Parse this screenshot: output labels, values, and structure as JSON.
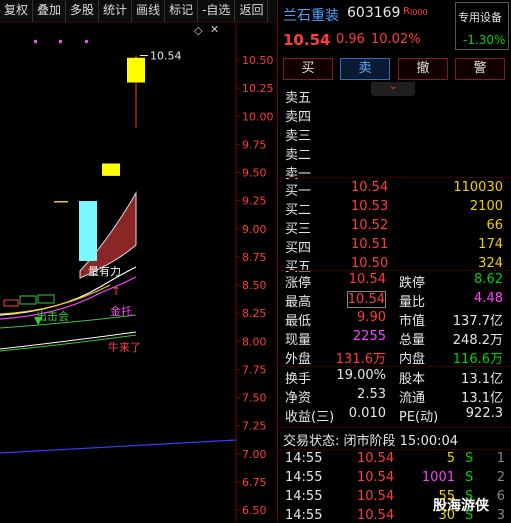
{
  "toolbar": [
    "复权",
    "叠加",
    "多股",
    "统计",
    "画线",
    "标记",
    "-自选",
    "返回"
  ],
  "chart_data": {
    "type": "candlestick",
    "yticks": [
      "10.50",
      "10.25",
      "10.00",
      "9.75",
      "9.50",
      "9.25",
      "9.00",
      "8.75",
      "8.50",
      "8.25",
      "8.00",
      "7.75",
      "7.50",
      "7.25",
      "7.00",
      "6.75",
      "6.50"
    ],
    "ylim": [
      6.5,
      10.6
    ],
    "high_label": "10.54",
    "annotations": [
      "量有力",
      "金托",
      "牛来了",
      "出击会"
    ],
    "candles": [
      {
        "open": 9.47,
        "close": 9.58,
        "high": 9.58,
        "low": 9.47,
        "color": "yellow"
      },
      {
        "open": 10.3,
        "close": 10.52,
        "high": 10.54,
        "low": 9.9,
        "color": "yellow"
      }
    ]
  },
  "stock": {
    "name": "兰石重装",
    "code": "603169",
    "tag": "R",
    "tag2": "I000",
    "sector": "专用设备",
    "sector_pct": "-1.30%",
    "price": "10.54",
    "change": "0.96",
    "pct": "10.02%"
  },
  "buttons": [
    "买",
    "卖",
    "撤",
    "警"
  ],
  "sell": [
    {
      "label": "卖五"
    },
    {
      "label": "卖四"
    },
    {
      "label": "卖三"
    },
    {
      "label": "卖二"
    },
    {
      "label": "卖一"
    }
  ],
  "buy": [
    {
      "label": "买一",
      "price": "10.54",
      "vol": "110030"
    },
    {
      "label": "买二",
      "price": "10.53",
      "vol": "2100"
    },
    {
      "label": "买三",
      "price": "10.52",
      "vol": "66"
    },
    {
      "label": "买四",
      "price": "10.51",
      "vol": "174"
    },
    {
      "label": "买五",
      "price": "10.50",
      "vol": "324"
    }
  ],
  "stats": [
    {
      "l1": "涨停",
      "v1": "10.54",
      "l2": "跌停",
      "v2": "8.62"
    },
    {
      "l1": "最高",
      "v1": "10.54",
      "l2": "量比",
      "v2": "4.48"
    },
    {
      "l1": "最低",
      "v1": "9.90",
      "l2": "市值",
      "v2": "137.7亿"
    },
    {
      "l1": "现量",
      "v1": "2255",
      "l2": "总量",
      "v2": "248.2万"
    },
    {
      "l1": "外盘",
      "v1": "131.6万",
      "l2": "内盘",
      "v2": "116.6万"
    }
  ],
  "stats2": [
    {
      "l1": "换手",
      "v1": "19.00%",
      "l2": "股本",
      "v2": "13.1亿"
    },
    {
      "l1": "净资",
      "v1": "2.53",
      "l2": "流通",
      "v2": "13.1亿"
    },
    {
      "l1": "收益(三)",
      "v1": "0.010",
      "l2": "PE(动)",
      "v2": "922.3"
    }
  ],
  "status": "交易状态: 闭市阶段 15:00:04",
  "ticks": [
    {
      "time": "14:55",
      "price": "10.54",
      "vol": "5",
      "side": "S",
      "n": "1"
    },
    {
      "time": "14:55",
      "price": "10.54",
      "vol": "1001",
      "side": "S",
      "n": "2"
    },
    {
      "time": "14:55",
      "price": "10.54",
      "vol": "55",
      "side": "S",
      "n": "6"
    },
    {
      "time": "14:55",
      "price": "10.54",
      "vol": "30",
      "side": "S",
      "n": "3"
    }
  ],
  "watermark": "股海游侠"
}
